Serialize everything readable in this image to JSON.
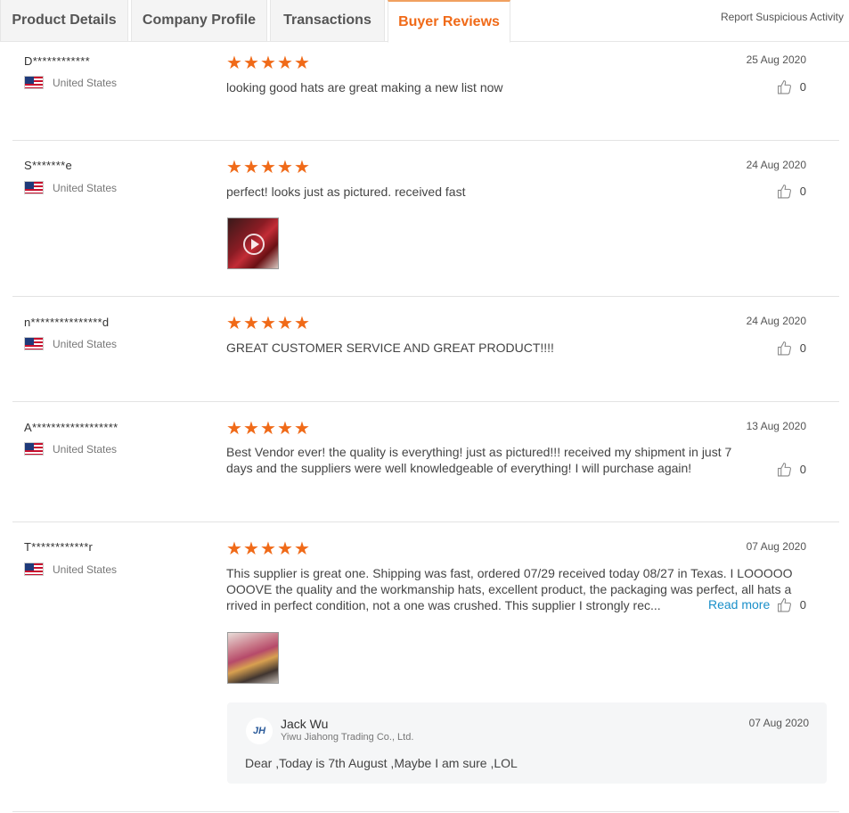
{
  "tabs": [
    {
      "label": "Product Details"
    },
    {
      "label": "Company Profile"
    },
    {
      "label": "Transactions"
    },
    {
      "label": "Buyer Reviews"
    }
  ],
  "report_link": "Report Suspicious Activity",
  "rating": "5",
  "accent_color": "#f06a18",
  "reviews": [
    {
      "name": "D************",
      "country": "United States",
      "date": "25 Aug 2020",
      "likes": "0",
      "text": "looking good hats are great making a new list  now"
    },
    {
      "name": "S*******e",
      "country": "United States",
      "date": "24 Aug 2020",
      "likes": "0",
      "text": "perfect! looks just as pictured. received fast"
    },
    {
      "name": "n***************d",
      "country": "United States",
      "date": "24 Aug 2020",
      "likes": "0",
      "text": "GREAT CUSTOMER SERVICE AND GREAT PRODUCT!!!!"
    },
    {
      "name": "A******************",
      "country": "United States",
      "date": "13 Aug 2020",
      "likes": "0",
      "text_lines": [
        "Best Vendor ever! the quality is everything! just as pictured!!! received my shipment in just 7",
        "days and the suppliers were well knowledgeable of everything! I will purchase again!"
      ]
    },
    {
      "name": "T************r",
      "country": "United States",
      "date": "07 Aug 2020",
      "likes": "0",
      "text_lines": [
        "This supplier is great one. Shipping was fast, ordered 07/29 received today 08/27 in Texas. I LOOOOO",
        "OOOVE the quality and the workmanship hats, excellent product, the packaging was perfect, all hats a",
        "rrived in perfect condition, not a one was crushed. This supplier I strongly rec..."
      ],
      "read_more": "Read more",
      "reply": {
        "logo_text": "JH",
        "name": "Jack Wu",
        "company": "Yiwu Jiahong Trading Co., Ltd.",
        "date": "07 Aug 2020",
        "text": "Dear ,Today is 7th August ,Maybe I am sure ,LOL"
      }
    }
  ]
}
